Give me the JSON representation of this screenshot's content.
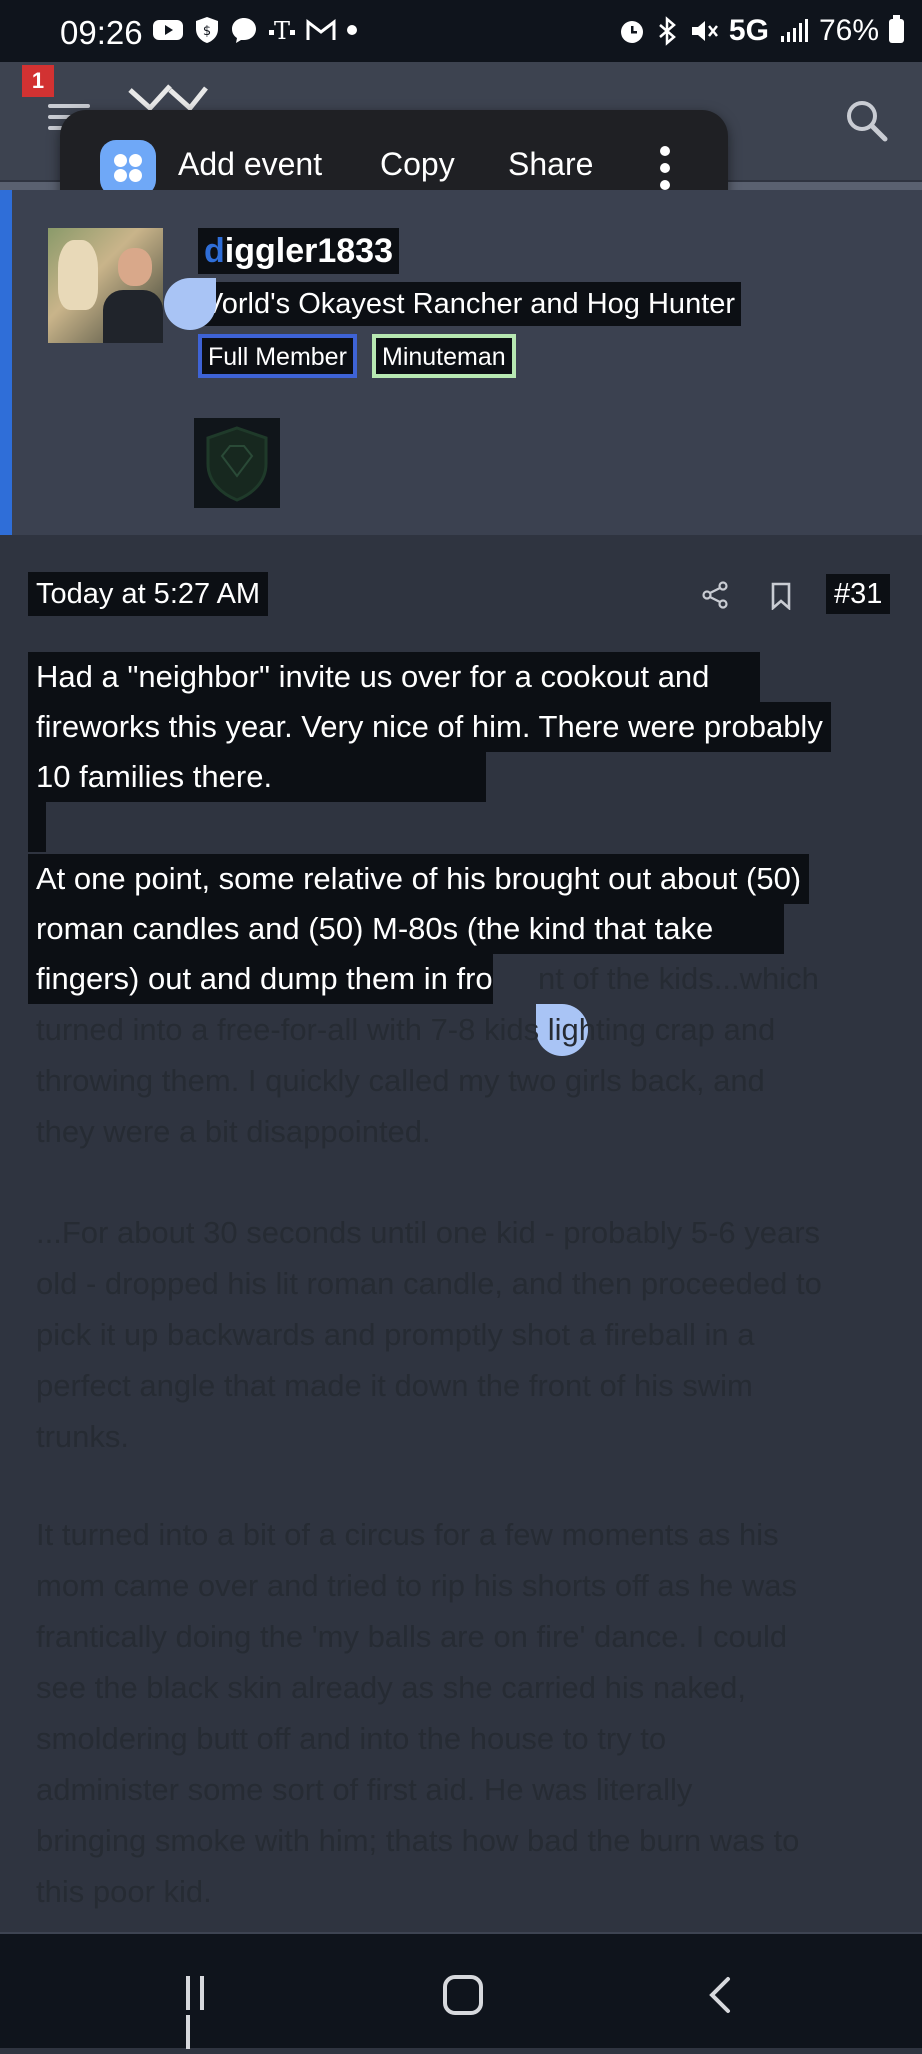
{
  "status_bar": {
    "time": "09:26",
    "network": "5G",
    "battery": "76%",
    "left_icons": [
      "youtube-icon",
      "vpn-icon",
      "messenger-icon",
      "tmobile-icon",
      "gmail-icon",
      "dot-icon"
    ],
    "right_icons": [
      "alarm-icon",
      "bluetooth-icon",
      "mute-icon",
      "signal-icon",
      "battery-icon"
    ]
  },
  "header": {
    "notification_count": "1",
    "icons": [
      "menu-icon",
      "logo-icon",
      "search-icon"
    ]
  },
  "selection_toolbar": {
    "items": [
      {
        "label": "Add event"
      },
      {
        "label": "Copy"
      },
      {
        "label": "Share"
      }
    ]
  },
  "user": {
    "username_first": "d",
    "username_rest": "iggler1833",
    "title": "World's Okayest Rancher and Hog Hunter",
    "title_display": "Vorld's Okayest Rancher and Hog Hunter",
    "badges": [
      "Full Member",
      "Minuteman"
    ]
  },
  "post": {
    "date": "Today at 5:27 AM",
    "number": "#31",
    "lines": [
      "Had a \"neighbor\" invite us over for a cookout and",
      "fireworks this year. Very nice of him. There were probably",
      "10 families there.",
      "At one point, some relative of his brought out about (50)",
      "roman candles and (50) M-80s (the kind that take",
      "fingers) out and dump them in fro",
      "nt of the kids...which",
      "turned into a free-for-all with 7-8 kids lighting crap and",
      "throwing them. I quickly called my two girls back, and",
      "they were a bit disappointed.",
      "...For about 30 seconds until one kid - probably 5-6 years",
      "old - dropped his lit roman candle, and then proceeded to",
      "pick it up backwards and promptly shot a fireball in a",
      "perfect angle that made it down the front of his swim",
      "trunks.",
      "It turned into a bit of a circus for a few moments as his",
      "mom came over and tried to rip his shorts off as he was",
      "frantically doing the 'my balls are on fire' dance. I could",
      "see the black skin already as she carried his naked,",
      "smoldering butt off and into the house to try to",
      "administer some sort of first aid. He was literally",
      "bringing smoke with him; thats how bad the burn was to",
      "this poor kid."
    ]
  },
  "nav_bar": {
    "icons": [
      "recent-apps-icon",
      "home-icon",
      "back-icon"
    ]
  }
}
